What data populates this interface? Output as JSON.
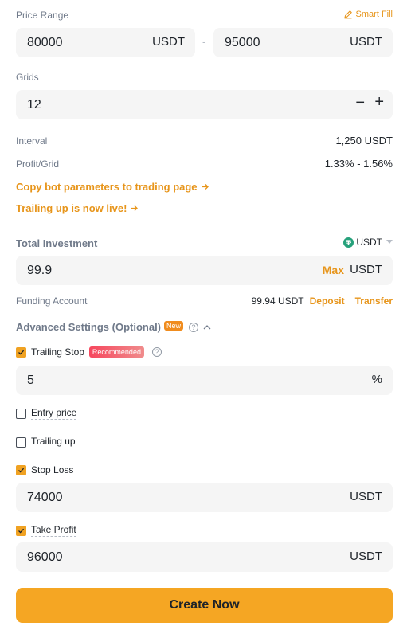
{
  "price_range": {
    "label": "Price Range",
    "smart_fill": "Smart Fill",
    "low": "80000",
    "high": "95000",
    "unit": "USDT",
    "separator": "-"
  },
  "grids": {
    "label": "Grids",
    "value": "12",
    "minus": "−",
    "plus": "+"
  },
  "interval": {
    "label": "Interval",
    "value": "1,250 USDT"
  },
  "profit_grid": {
    "label": "Profit/Grid",
    "value": "1.33% - 1.56%"
  },
  "links": {
    "copy_params": "Copy bot parameters to trading page",
    "trailing_live": "Trailing up is now live!"
  },
  "investment": {
    "label": "Total Investment",
    "currency": "USDT",
    "value": "99.9",
    "max": "Max",
    "unit": "USDT"
  },
  "funding": {
    "label": "Funding Account",
    "balance": "99.94 USDT",
    "deposit": "Deposit",
    "transfer": "Transfer"
  },
  "advanced": {
    "label": "Advanced Settings (Optional)",
    "badge": "New"
  },
  "trailing_stop": {
    "label": "Trailing Stop",
    "badge": "Recommended",
    "checked": true,
    "value": "5",
    "unit": "%"
  },
  "entry_price": {
    "label": "Entry price",
    "checked": false
  },
  "trailing_up": {
    "label": "Trailing up",
    "checked": false
  },
  "stop_loss": {
    "label": "Stop Loss",
    "checked": true,
    "value": "74000",
    "unit": "USDT"
  },
  "take_profit": {
    "label": "Take Profit",
    "checked": true,
    "value": "96000",
    "unit": "USDT"
  },
  "create_button": "Create Now",
  "colors": {
    "accent": "#f0a222",
    "button": "#f5a623",
    "badge_red": "#f6465d",
    "badge_orange": "#f08c1e"
  }
}
